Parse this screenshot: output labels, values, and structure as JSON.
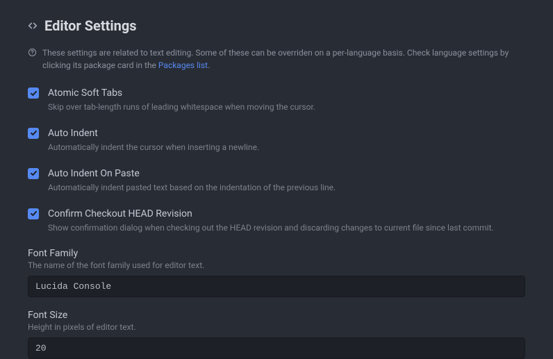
{
  "title": "Editor Settings",
  "intro": {
    "prefix": "These settings are related to text editing. Some of these can be overriden on a per-language basis. Check language settings by clicking its package card in the ",
    "link_text": "Packages list",
    "suffix": "."
  },
  "settings": {
    "atomic_soft_tabs": {
      "label": "Atomic Soft Tabs",
      "desc": "Skip over tab-length runs of leading whitespace when moving the cursor.",
      "checked": true
    },
    "auto_indent": {
      "label": "Auto Indent",
      "desc": "Automatically indent the cursor when inserting a newline.",
      "checked": true
    },
    "auto_indent_on_paste": {
      "label": "Auto Indent On Paste",
      "desc": "Automatically indent pasted text based on the indentation of the previous line.",
      "checked": true
    },
    "confirm_checkout_head": {
      "label": "Confirm Checkout HEAD Revision",
      "desc": "Show confirmation dialog when checking out the HEAD revision and discarding changes to current file since last commit.",
      "checked": true
    }
  },
  "fields": {
    "font_family": {
      "label": "Font Family",
      "desc": "The name of the font family used for editor text.",
      "value": "Lucida Console"
    },
    "font_size": {
      "label": "Font Size",
      "desc": "Height in pixels of editor text.",
      "value": "20"
    }
  }
}
